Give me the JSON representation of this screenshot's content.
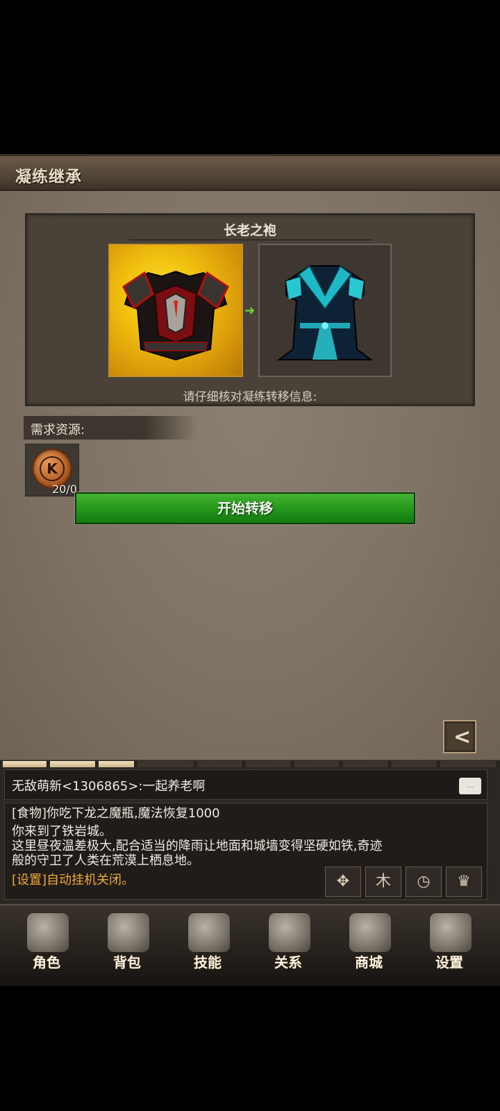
{
  "panel": {
    "title": "凝练继承",
    "item_name": "长老之袍",
    "hint": "请仔细核对凝练转移信息:",
    "requirements_label": "需求资源:",
    "resource": {
      "icon": "gold-k-coin-icon",
      "count": "20/0"
    },
    "start_button": "开始转移",
    "back_button": "<"
  },
  "chat": {
    "latest": "无敌萌新<1306865>:一起养老啊",
    "bubble": "...",
    "log": [
      {
        "text": "[食物]你吃下龙之魔瓶,魔法恢复1000",
        "color": "white"
      },
      {
        "text": "你来到了铁岩城。",
        "color": "white"
      },
      {
        "text": "这里昼夜温差极大,配合适当的降雨让地面和城墙变得坚硬如铁,奇迹",
        "color": "white"
      },
      {
        "text": "般的守卫了人类在荒漠上栖息地。",
        "color": "white"
      },
      {
        "text": "[设置]自动挂机关闭。",
        "color": "gold"
      }
    ],
    "tool_icons": [
      "crossed-swords-icon",
      "tree-icon",
      "clock-icon",
      "trophy-icon"
    ]
  },
  "nav": [
    {
      "label": "角色",
      "icon": "helmet-icon"
    },
    {
      "label": "背包",
      "icon": "skull-bag-icon"
    },
    {
      "label": "技能",
      "icon": "spellbook-icon"
    },
    {
      "label": "关系",
      "icon": "handshake-icon"
    },
    {
      "label": "商城",
      "icon": "treasure-chest-icon"
    },
    {
      "label": "设置",
      "icon": "gears-icon"
    }
  ],
  "colors": {
    "start_button": "#279a1d",
    "gold_text": "#f1a93a",
    "source_slot": "#f2c20f"
  }
}
